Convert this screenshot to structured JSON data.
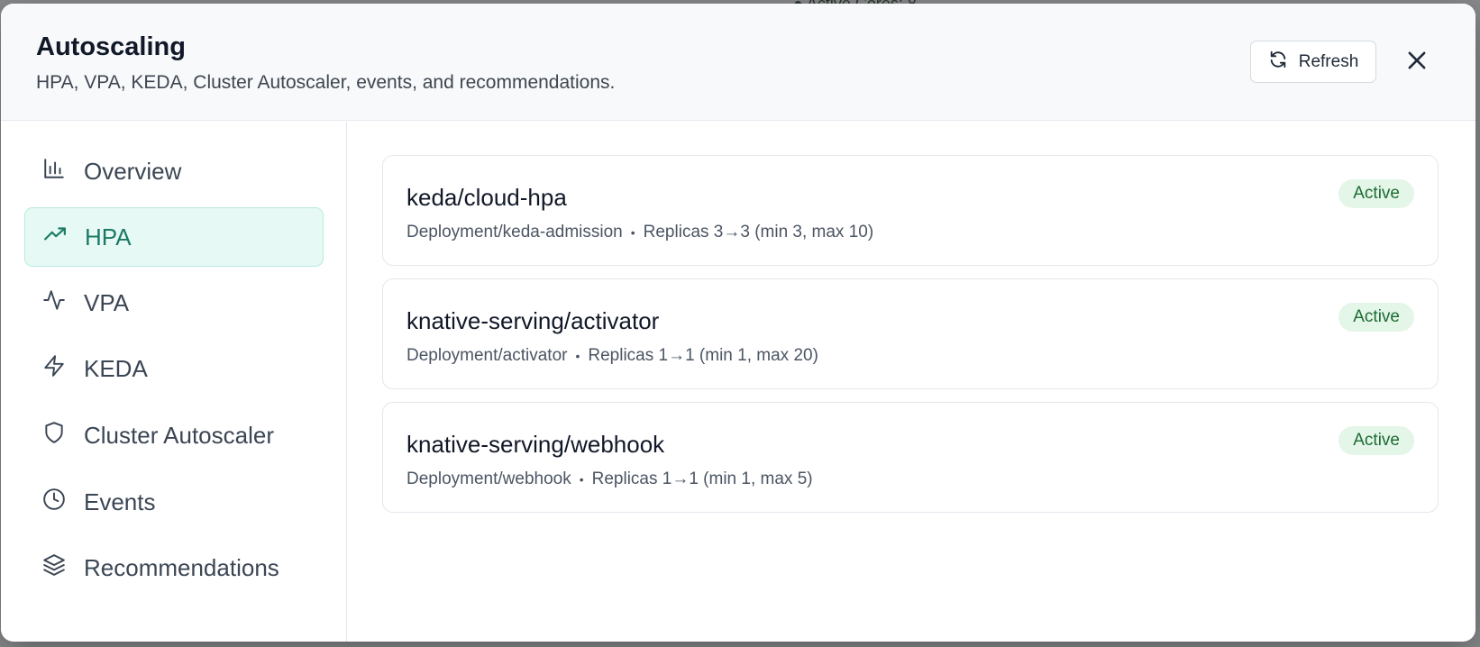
{
  "modal": {
    "title": "Autoscaling",
    "subtitle": "HPA, VPA, KEDA, Cluster Autoscaler, events, and recommendations.",
    "refresh_label": "Refresh",
    "close_icon": "close-icon"
  },
  "sidebar": {
    "items": [
      {
        "label": "Overview",
        "icon": "bar-chart-icon",
        "active": false
      },
      {
        "label": "HPA",
        "icon": "trending-up-icon",
        "active": true
      },
      {
        "label": "VPA",
        "icon": "activity-icon",
        "active": false
      },
      {
        "label": "KEDA",
        "icon": "lightning-icon",
        "active": false
      },
      {
        "label": "Cluster Autoscaler",
        "icon": "shield-icon",
        "active": false
      },
      {
        "label": "Events",
        "icon": "clock-icon",
        "active": false
      },
      {
        "label": "Recommendations",
        "icon": "layers-icon",
        "active": false
      }
    ]
  },
  "hpa_list": [
    {
      "name": "keda/cloud-hpa",
      "target": "Deployment/keda-admission",
      "replicas": "Replicas 3→3 (min 3, max 10)",
      "status": "Active"
    },
    {
      "name": "knative-serving/activator",
      "target": "Deployment/activator",
      "replicas": "Replicas 1→1 (min 1, max 20)",
      "status": "Active"
    },
    {
      "name": "knative-serving/webhook",
      "target": "Deployment/webhook",
      "replicas": "Replicas 1→1 (min 1, max 5)",
      "status": "Active"
    }
  ],
  "colors": {
    "accent": "#1b7a66",
    "active_bg": "#e6f9f4",
    "badge_bg": "#e4f6e8",
    "badge_text": "#1e6b34"
  }
}
